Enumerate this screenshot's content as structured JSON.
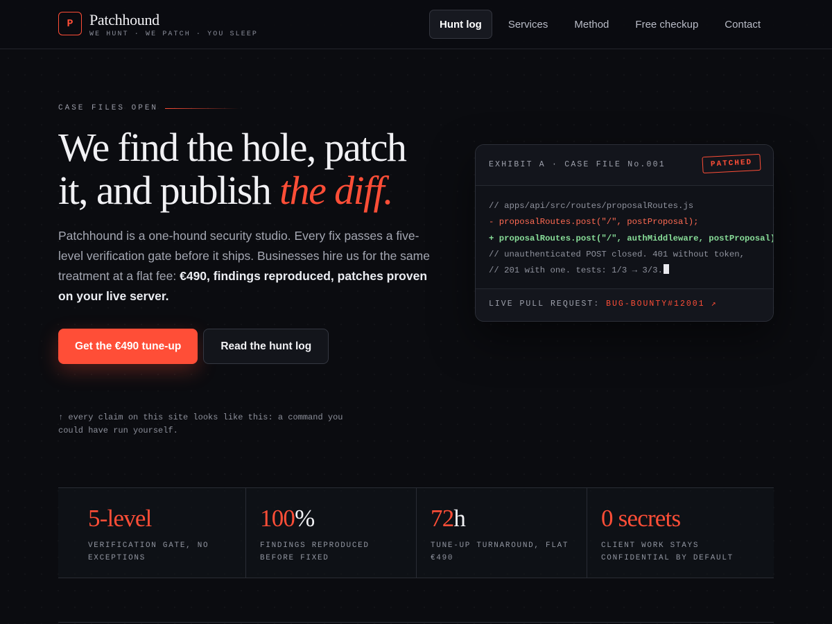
{
  "brand": {
    "logo_letter": "P",
    "name": "Patchhound",
    "tagline": "WE HUNT · WE PATCH · YOU SLEEP",
    "accent_color": "#ff4e37"
  },
  "nav": {
    "items": [
      {
        "label": "Hunt log",
        "active": true
      },
      {
        "label": "Services",
        "active": false
      },
      {
        "label": "Method",
        "active": false
      },
      {
        "label": "Free checkup",
        "active": false
      },
      {
        "label": "Contact",
        "active": false
      }
    ]
  },
  "hero": {
    "eyebrow": "CASE FILES OPEN",
    "title_line1": "We find the hole, patch",
    "title_line2": "it, and publish ",
    "title_accent": "the diff.",
    "description_plain": "Patchhound is a one-hound security studio. Every fix passes a five-level verification gate before it ships. Businesses hire us for the same treatment at a flat fee: ",
    "description_bold": "€490, findings reproduced, patches proven on your live server.",
    "cta_primary": "Get the €490 tune-up",
    "cta_secondary": "Read the hunt log",
    "footnote": "↑ every claim on this site looks like this: a command you could have run yourself."
  },
  "exhibit": {
    "title": "EXHIBIT A · CASE FILE No.001",
    "stamp": "PATCHED",
    "code_lines": [
      {
        "kind": "comment",
        "text": "// apps/api/src/routes/proposalRoutes.js"
      },
      {
        "kind": "del",
        "text": "- proposalRoutes.post(\"/\", postProposal);"
      },
      {
        "kind": "add",
        "text": "+ proposalRoutes.post(\"/\", authMiddleware, postProposal);"
      },
      {
        "kind": "comment",
        "text": "// unauthenticated POST closed. 401 without token,"
      },
      {
        "kind": "comment",
        "text": "// 201 with one. tests: 1/3 → 3/3."
      }
    ],
    "footer_label": "LIVE PULL REQUEST: ",
    "footer_link": "BUG-BOUNTY#12001 ↗"
  },
  "stats": [
    {
      "accent": "5-level",
      "unit": "",
      "label": "VERIFICATION GATE, NO EXCEPTIONS"
    },
    {
      "accent": "100",
      "unit": "%",
      "label": "FINDINGS REPRODUCED BEFORE FIXED"
    },
    {
      "accent": "72",
      "unit": "h",
      "label": "TUNE-UP TURNAROUND, FLAT €490"
    },
    {
      "accent": "0 secrets",
      "unit": "",
      "label": "CLIENT WORK STAYS CONFIDENTIAL BY DEFAULT"
    }
  ]
}
